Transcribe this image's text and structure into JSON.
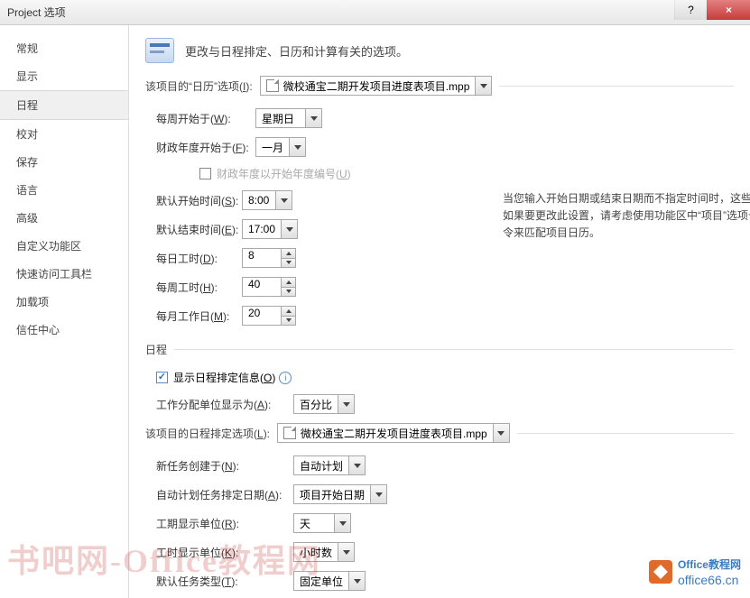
{
  "window": {
    "title": "Project 选项"
  },
  "sidebar": {
    "items": [
      {
        "label": "常规"
      },
      {
        "label": "显示"
      },
      {
        "label": "日程",
        "active": true
      },
      {
        "label": "校对"
      },
      {
        "label": "保存"
      },
      {
        "label": "语言"
      },
      {
        "label": "高级"
      },
      {
        "label": "自定义功能区"
      },
      {
        "label": "快速访问工具栏"
      },
      {
        "label": "加载项"
      },
      {
        "label": "信任中心"
      }
    ]
  },
  "header": {
    "description": "更改与日程排定、日历和计算有关的选项。"
  },
  "sections": {
    "calendar": {
      "title_prefix": "该项目的“日历”选项(",
      "title_letter": "I",
      "title_suffix": "):",
      "project_file": "微校通宝二期开发项目进度表项目.mpp",
      "week_start_label_pre": "每周开始于(",
      "week_start_letter": "W",
      "week_start_label_post": "):",
      "week_start_value": "星期日",
      "fy_start_label_pre": "财政年度开始于(",
      "fy_start_letter": "F",
      "fy_start_label_post": "):",
      "fy_start_value": "一月",
      "fy_numbering_label_pre": "财政年度以开始年度编号(",
      "fy_numbering_letter": "U",
      "fy_numbering_label_post": ")",
      "default_start_label_pre": "默认开始时间(",
      "default_start_letter": "S",
      "default_start_label_post": "):",
      "default_start_value": "8:00",
      "default_end_label_pre": "默认结束时间(",
      "default_end_letter": "E",
      "default_end_label_post": "):",
      "default_end_value": "17:00",
      "hours_per_day_label_pre": "每日工时(",
      "hours_per_day_letter": "D",
      "hours_per_day_label_post": "):",
      "hours_per_day_value": "8",
      "hours_per_week_label_pre": "每周工时(",
      "hours_per_week_letter": "H",
      "hours_per_week_label_post": "):",
      "hours_per_week_value": "40",
      "days_per_month_label_pre": "每月工作日(",
      "days_per_month_letter": "M",
      "days_per_month_label_post": "):",
      "days_per_month_value": "20",
      "side_note": "当您输入开始日期或结束日期而不指定时间时，这些时间会被分配给任务。如果要更改此设置，请考虑使用功能区中“项目”选项卡上的“更改工作时间”命令来匹配项目日历。"
    },
    "schedule": {
      "title": "日程",
      "show_info_label_pre": "显示日程排定信息(",
      "show_info_letter": "O",
      "show_info_label_post": ")",
      "assignment_units_label_pre": "工作分配单位显示为(",
      "assignment_units_letter": "A",
      "assignment_units_label_post": "):",
      "assignment_units_value": "百分比"
    },
    "sched_options": {
      "title_prefix": "该项目的日程排定选项(",
      "title_letter": "L",
      "title_suffix": "):",
      "project_file": "微校通宝二期开发项目进度表项目.mpp",
      "new_tasks_label_pre": "新任务创建于(",
      "new_tasks_letter": "N",
      "new_tasks_label_post": "):",
      "new_tasks_value": "自动计划",
      "auto_sched_label_pre": "自动计划任务排定日期(",
      "auto_sched_letter": "A",
      "auto_sched_label_post": "):",
      "auto_sched_value": "项目开始日期",
      "duration_units_label_pre": "工期显示单位(",
      "duration_units_letter": "R",
      "duration_units_label_post": "):",
      "duration_units_value": "天",
      "work_units_label_pre": "工时显示单位(",
      "work_units_letter": "K",
      "work_units_label_post": "):",
      "work_units_value": "小时数",
      "default_task_type_label_pre": "默认任务类型(",
      "default_task_type_letter": "T",
      "default_task_type_label_post": "):",
      "default_task_type_value": "固定单位"
    }
  },
  "watermarks": {
    "wm1": "书吧网-Office教程网",
    "wm2a": "Office",
    "wm2b": "教程网",
    "wm2c": "office66.cn"
  }
}
